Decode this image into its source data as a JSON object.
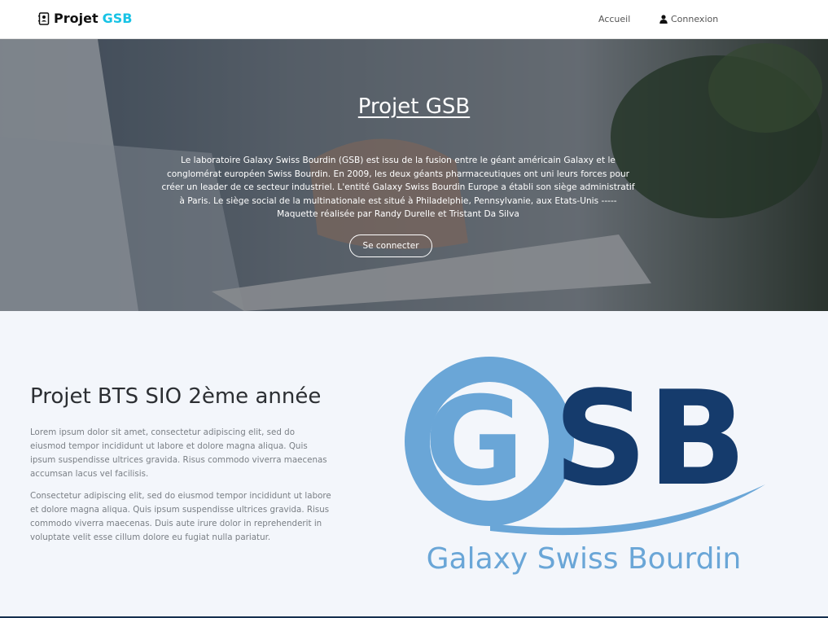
{
  "navbar": {
    "brand": "Projet",
    "brand_accent": "GSB",
    "home_label": "Accueil",
    "login_label": "Connexion"
  },
  "hero": {
    "title": "Projet GSB",
    "description": "Le laboratoire Galaxy Swiss Bourdin (GSB) est issu de la fusion entre le géant américain Galaxy et le conglomérat européen Swiss Bourdin. En 2009, les deux géants pharmaceutiques ont uni leurs forces pour créer un leader de ce secteur industriel. L'entité Galaxy Swiss Bourdin Europe a établi son siège administratif à Paris. Le siège social de la multinationale est situé à Philadelphie, Pennsylvanie, aux Etats-Unis ----- Maquette réalisée par Randy Durelle et Tristant Da Silva",
    "button_label": "Se connecter"
  },
  "about": {
    "title": "Projet BTS SIO 2ème année",
    "paragraph1": "Lorem ipsum dolor sit amet, consectetur adipiscing elit, sed do eiusmod tempor incididunt ut labore et dolore magna aliqua. Quis ipsum suspendisse ultrices gravida. Risus commodo viverra maecenas accumsan lacus vel facilisis.",
    "paragraph2": "Consectetur adipiscing elit, sed do eiusmod tempor incididunt ut labore et dolore magna aliqua. Quis ipsum suspendisse ultrices gravida. Risus commodo viverra maecenas. Duis aute irure dolor in reprehenderit in voluptate velit esse cillum dolore eu fugiat nulla pariatur."
  },
  "logo": {
    "letters": "GSB",
    "tagline": "Galaxy Swiss Bourdin"
  },
  "colors": {
    "brand_accent": "#17c3e5",
    "logo_light_blue": "#6aa6d7",
    "logo_dark_blue": "#153b6c"
  }
}
